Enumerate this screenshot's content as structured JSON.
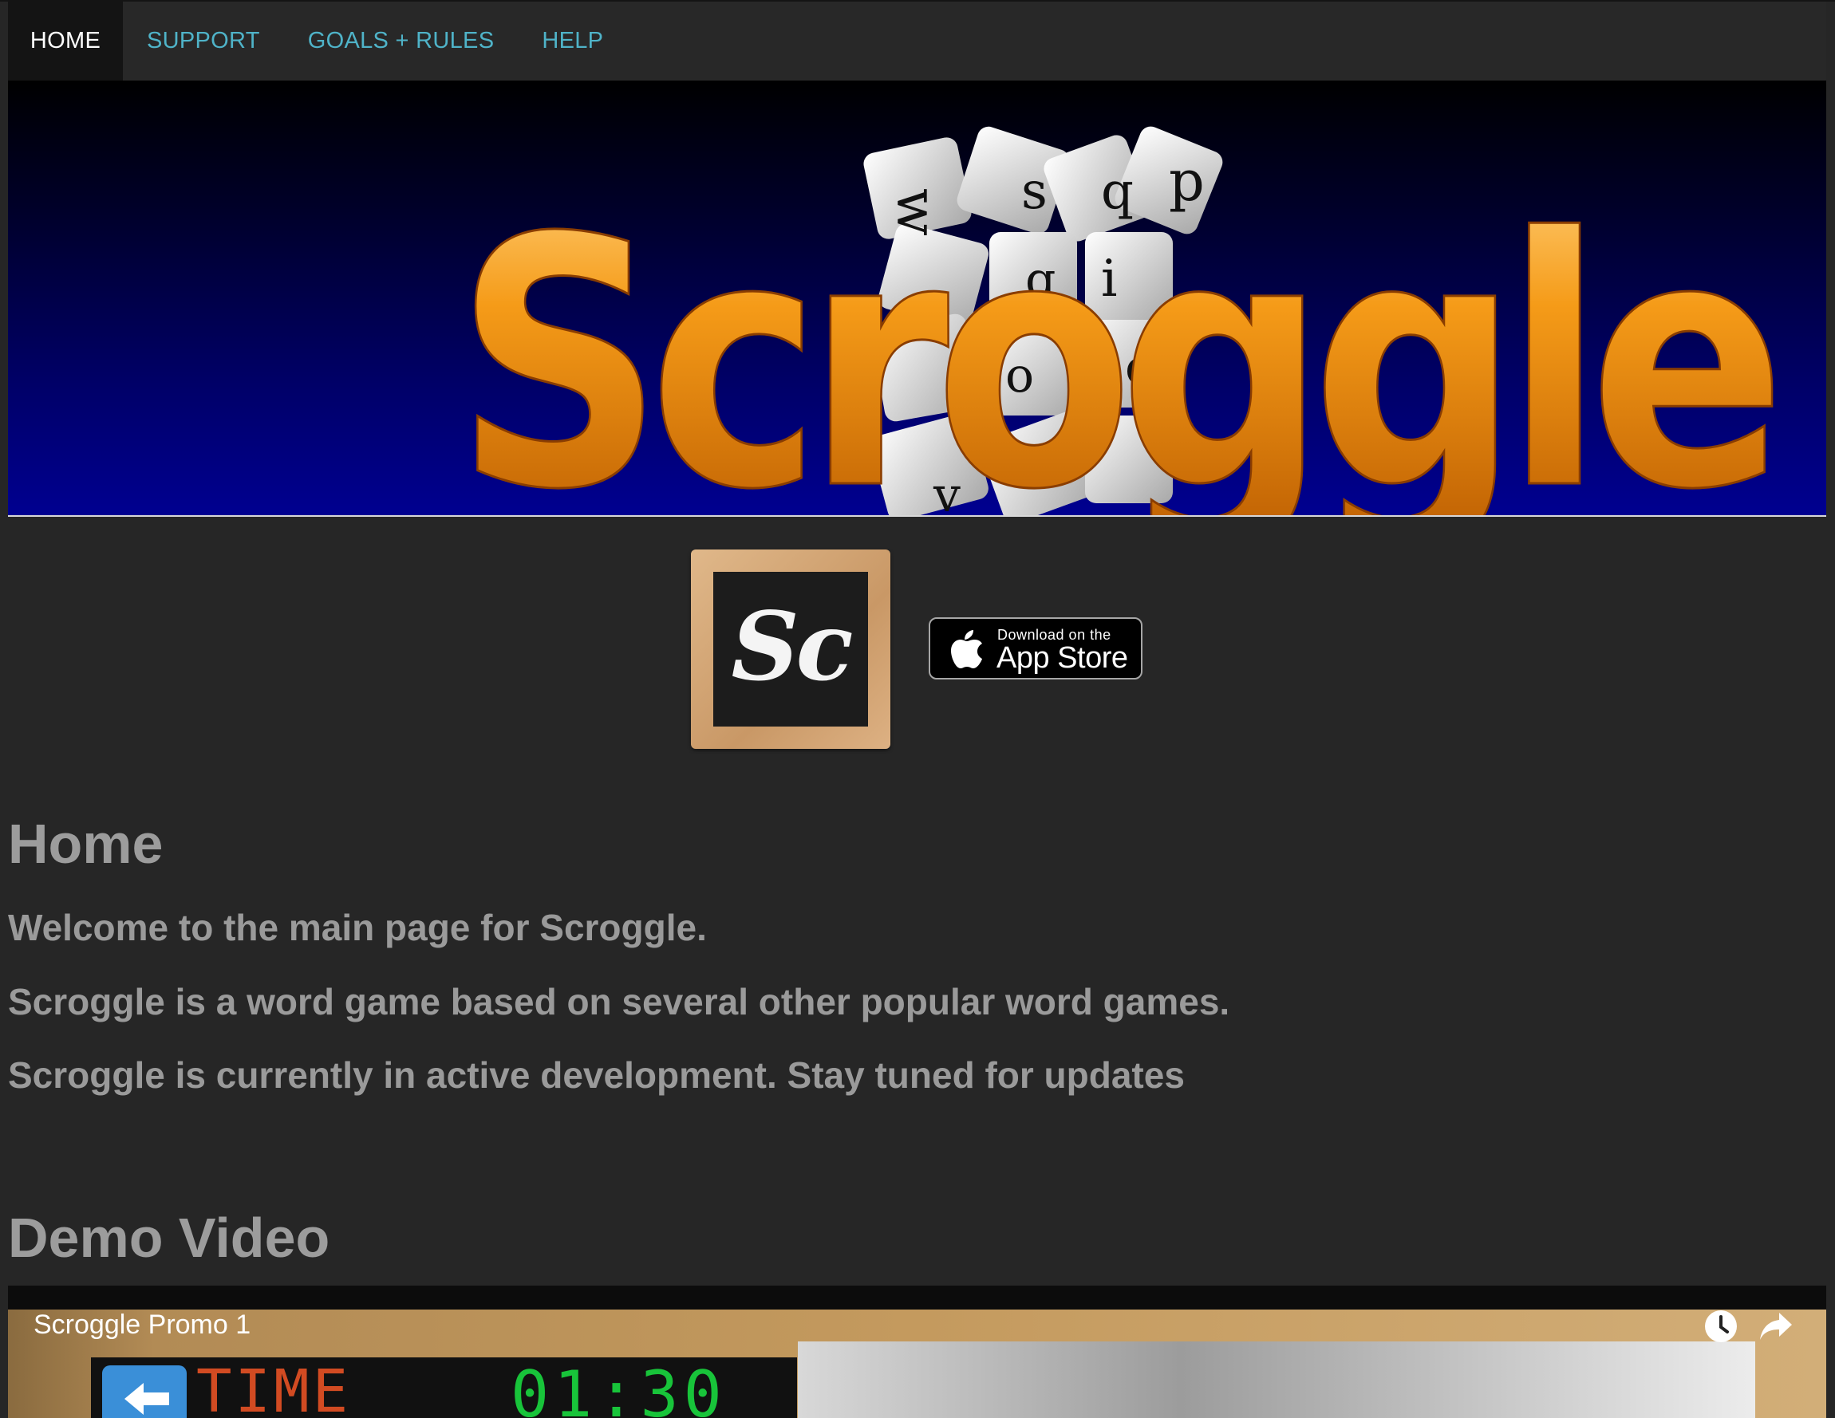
{
  "nav": {
    "items": [
      {
        "label": "HOME",
        "active": true
      },
      {
        "label": "SUPPORT",
        "active": false
      },
      {
        "label": "GOALS + RULES",
        "active": false
      },
      {
        "label": "HELP",
        "active": false
      }
    ]
  },
  "banner": {
    "title": "Scroggle"
  },
  "app_icon": {
    "text": "Sc"
  },
  "appstore": {
    "small": "Download on the",
    "big": "App Store"
  },
  "home": {
    "heading": "Home",
    "paragraphs": [
      "Welcome to the main page for Scroggle.",
      "Scroggle is a word game based on several other popular word games.",
      "Scroggle is currently in active development. Stay tuned for updates"
    ]
  },
  "demo": {
    "heading": "Demo Video",
    "video_title": "Scroggle Promo 1",
    "time_label": "TIME",
    "time_value": "01:30",
    "icons": [
      "watch-later-icon",
      "share-icon"
    ]
  },
  "colors": {
    "background": "#262626",
    "nav_link": "#4fb3c8",
    "text": "#9a9a9a",
    "logo_orange": "#f08a10"
  }
}
